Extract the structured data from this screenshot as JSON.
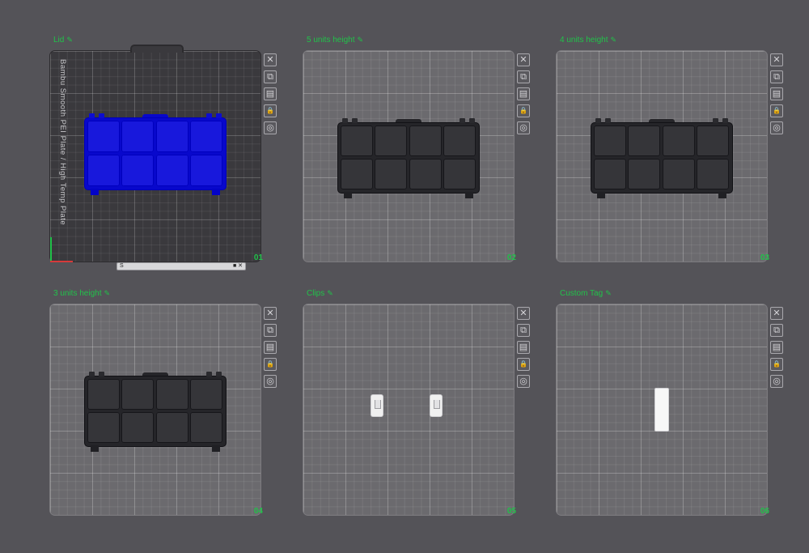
{
  "plates": [
    {
      "title": "Lid",
      "number": "01",
      "variant": "dark",
      "box_color": "#1212d6",
      "content": "box"
    },
    {
      "title": "5 units height",
      "number": "02",
      "variant": "light",
      "box_color": "#2f2f33",
      "content": "box"
    },
    {
      "title": "4 units height",
      "number": "03",
      "variant": "light",
      "box_color": "#2f2f33",
      "content": "box"
    },
    {
      "title": "3 units height",
      "number": "04",
      "variant": "light",
      "box_color": "#2f2f33",
      "content": "box"
    },
    {
      "title": "Clips",
      "number": "05",
      "variant": "light",
      "content": "clips"
    },
    {
      "title": "Custom Tag",
      "number": "06",
      "variant": "light",
      "content": "tag"
    }
  ],
  "plate_1_label": "Bambu Smooth PEI Plate / High Temp Plate",
  "plate_1_bar": {
    "left": "S",
    "right": "■ ✕"
  },
  "icons": [
    "close-icon",
    "auto-orient-icon",
    "arrange-icon",
    "lock-icon",
    "settings-icon"
  ],
  "icon_glyphs": {
    "close-icon": "✕",
    "auto-orient-icon": "⧉",
    "arrange-icon": "▤",
    "lock-icon": "🔒",
    "settings-icon": "◎"
  },
  "accent_color": "#21c24a"
}
